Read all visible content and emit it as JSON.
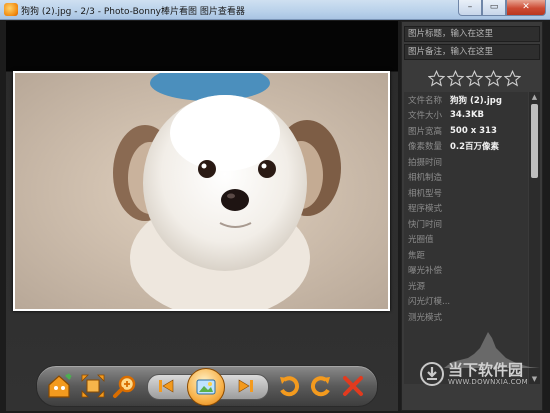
{
  "window": {
    "title": "狗狗 (2).jpg - 2/3 - Photo-Bonny棒片看图 图片查看器",
    "minimize": "–",
    "maximize": "▭",
    "close": "✕"
  },
  "panel": {
    "title_placeholder": "图片标题，输入在这里",
    "note_placeholder": "图片备注，输入在这里",
    "rating": 0,
    "rating_max": 5,
    "properties": [
      {
        "key": "文件名称",
        "value": "狗狗 (2).jpg"
      },
      {
        "key": "文件大小",
        "value": "34.3KB"
      },
      {
        "key": "图片宽高",
        "value": "500 x 313"
      },
      {
        "key": "像素数量",
        "value": "0.2百万像素"
      },
      {
        "key": "拍摄时间",
        "value": ""
      },
      {
        "key": "相机制造",
        "value": ""
      },
      {
        "key": "相机型号",
        "value": ""
      },
      {
        "key": "程序模式",
        "value": ""
      },
      {
        "key": "快门时间",
        "value": ""
      },
      {
        "key": "光圈值",
        "value": ""
      },
      {
        "key": "焦距",
        "value": ""
      },
      {
        "key": "曝光补偿",
        "value": ""
      },
      {
        "key": "光源",
        "value": ""
      },
      {
        "key": "闪光灯模...",
        "value": ""
      },
      {
        "key": "测光模式",
        "value": ""
      }
    ]
  },
  "watermark": {
    "text_cn": "当下软件园",
    "text_en": "WWW.DOWNXIA.COM"
  },
  "toolbar": {
    "buttons": [
      "home-icon",
      "fit-screen-icon",
      "zoom-icon",
      "previous-icon",
      "slideshow-icon",
      "next-icon",
      "rotate-left-icon",
      "rotate-right-icon",
      "delete-icon"
    ]
  },
  "colors": {
    "accent_orange": "#f39a1e",
    "delete_red": "#e23a1e",
    "panel_bg": "#3a3a3a",
    "viewer_bg": "#2b2b2b"
  }
}
